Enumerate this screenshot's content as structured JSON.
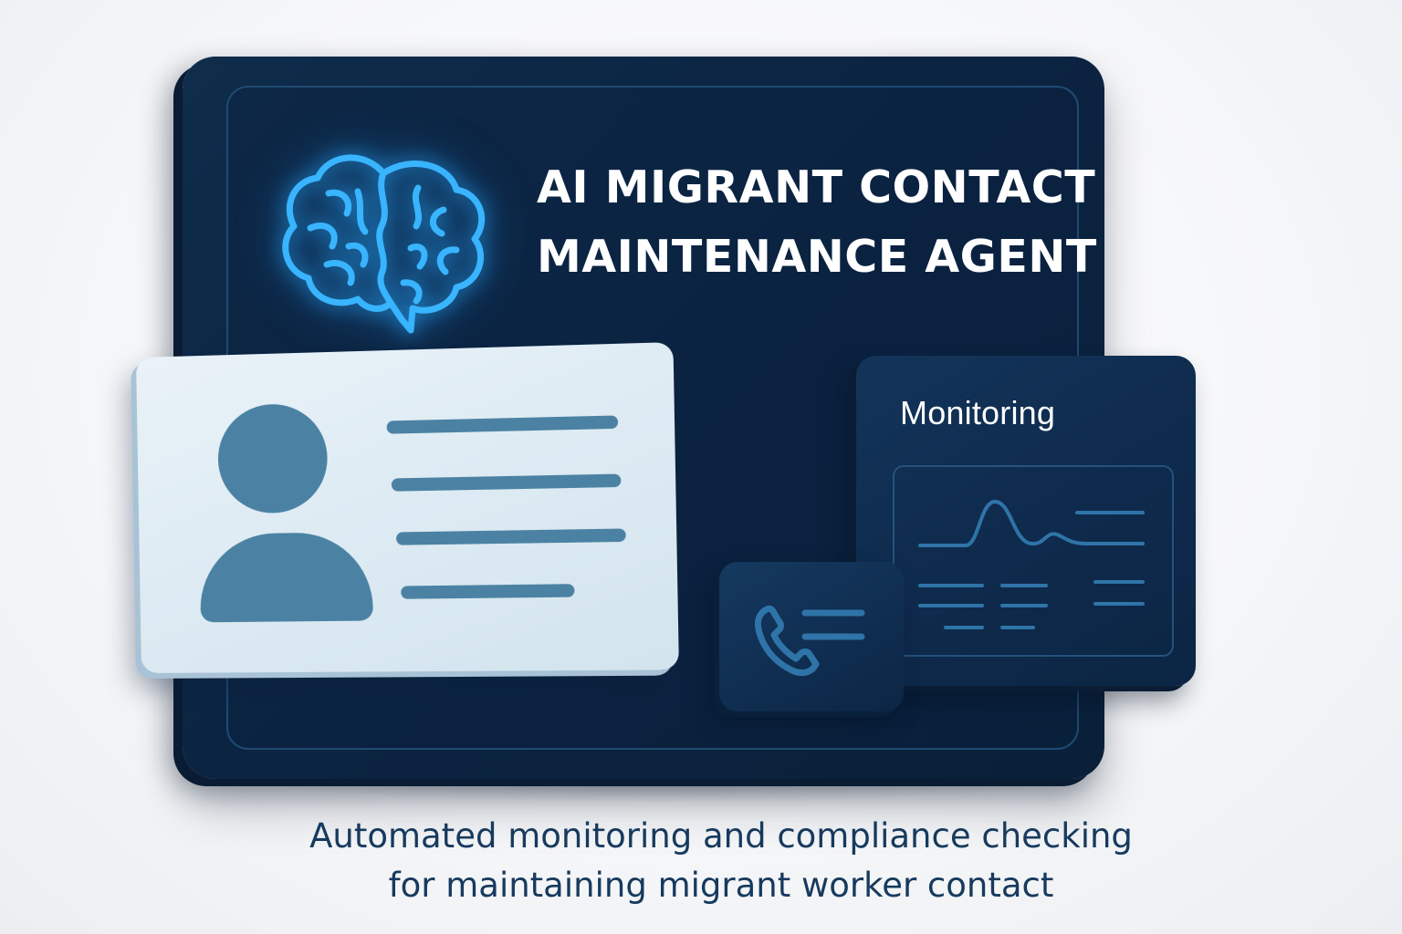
{
  "title": {
    "line1": "AI MIGRANT CONTACT",
    "line2": "MAINTENANCE AGENT"
  },
  "monitoring_panel": {
    "label": "Monitoring"
  },
  "caption": {
    "line1": "Automated monitoring and compliance checking",
    "line2": "for maintaining migrant worker contact"
  },
  "icons": {
    "brain": "brain-icon",
    "avatar": "user-avatar-icon",
    "phone": "phone-icon",
    "chart": "line-chart-icon"
  },
  "colors": {
    "screen": "#0b2442",
    "brain_glow": "#2ea8ff",
    "card": "#dbe9f2",
    "card_accent": "#4b82a3",
    "panel_accent": "#2f74a8",
    "caption_text": "#173a5e"
  }
}
